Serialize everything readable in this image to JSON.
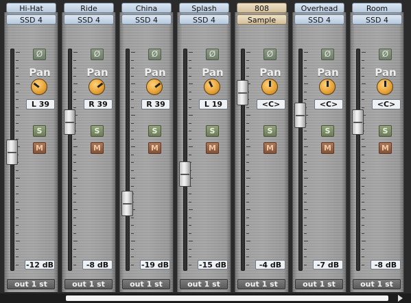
{
  "channels": [
    {
      "name": "Hi-Hat",
      "source": "SSD 4",
      "phase_label": "Ø",
      "pan_label": "Pan",
      "pan": "L 39",
      "solo": "S",
      "mute": "M",
      "level": "-12 dB",
      "output": "out 1 st",
      "fader_db": -12,
      "pan_pos": -0.39
    },
    {
      "name": "Ride",
      "source": "SSD 4",
      "phase_label": "Ø",
      "pan_label": "Pan",
      "pan": "R 39",
      "solo": "S",
      "mute": "M",
      "level": "-8 dB",
      "output": "out 1 st",
      "fader_db": -8,
      "pan_pos": 0.39
    },
    {
      "name": "China",
      "source": "SSD 4",
      "phase_label": "Ø",
      "pan_label": "Pan",
      "pan": "R 39",
      "solo": "S",
      "mute": "M",
      "level": "-19 dB",
      "output": "out 1 st",
      "fader_db": -19,
      "pan_pos": 0.39
    },
    {
      "name": "Splash",
      "source": "SSD 4",
      "phase_label": "Ø",
      "pan_label": "Pan",
      "pan": "L 19",
      "solo": "S",
      "mute": "M",
      "level": "-15 dB",
      "output": "out 1 st",
      "fader_db": -15,
      "pan_pos": -0.19
    },
    {
      "name": "808",
      "source": "Sample",
      "phase_label": "Ø",
      "pan_label": "Pan",
      "pan": "<C>",
      "solo": "S",
      "mute": "M",
      "level": "-4 dB",
      "output": "out 1 st",
      "fader_db": -4,
      "pan_pos": 0
    },
    {
      "name": "Overhead",
      "source": "SSD 4",
      "phase_label": "Ø",
      "pan_label": "Pan",
      "pan": "<C>",
      "solo": "S",
      "mute": "M",
      "level": "-7 dB",
      "output": "out 1 st",
      "fader_db": -7,
      "pan_pos": 0
    },
    {
      "name": "Room",
      "source": "SSD 4",
      "phase_label": "Ø",
      "pan_label": "Pan",
      "pan": "<C>",
      "solo": "S",
      "mute": "M",
      "level": "-8 dB",
      "output": "out 1 st",
      "fader_db": -8,
      "pan_pos": 0
    }
  ],
  "colors": {
    "knob": "#e6a43a",
    "solo": "#6d7b5b",
    "mute": "#82523a",
    "label_blue": "#b7c9dd",
    "label_sample": "#d2bf9c"
  },
  "icons": {
    "phase": "phase-invert-icon",
    "scroll_right": "arrow-right-icon"
  }
}
